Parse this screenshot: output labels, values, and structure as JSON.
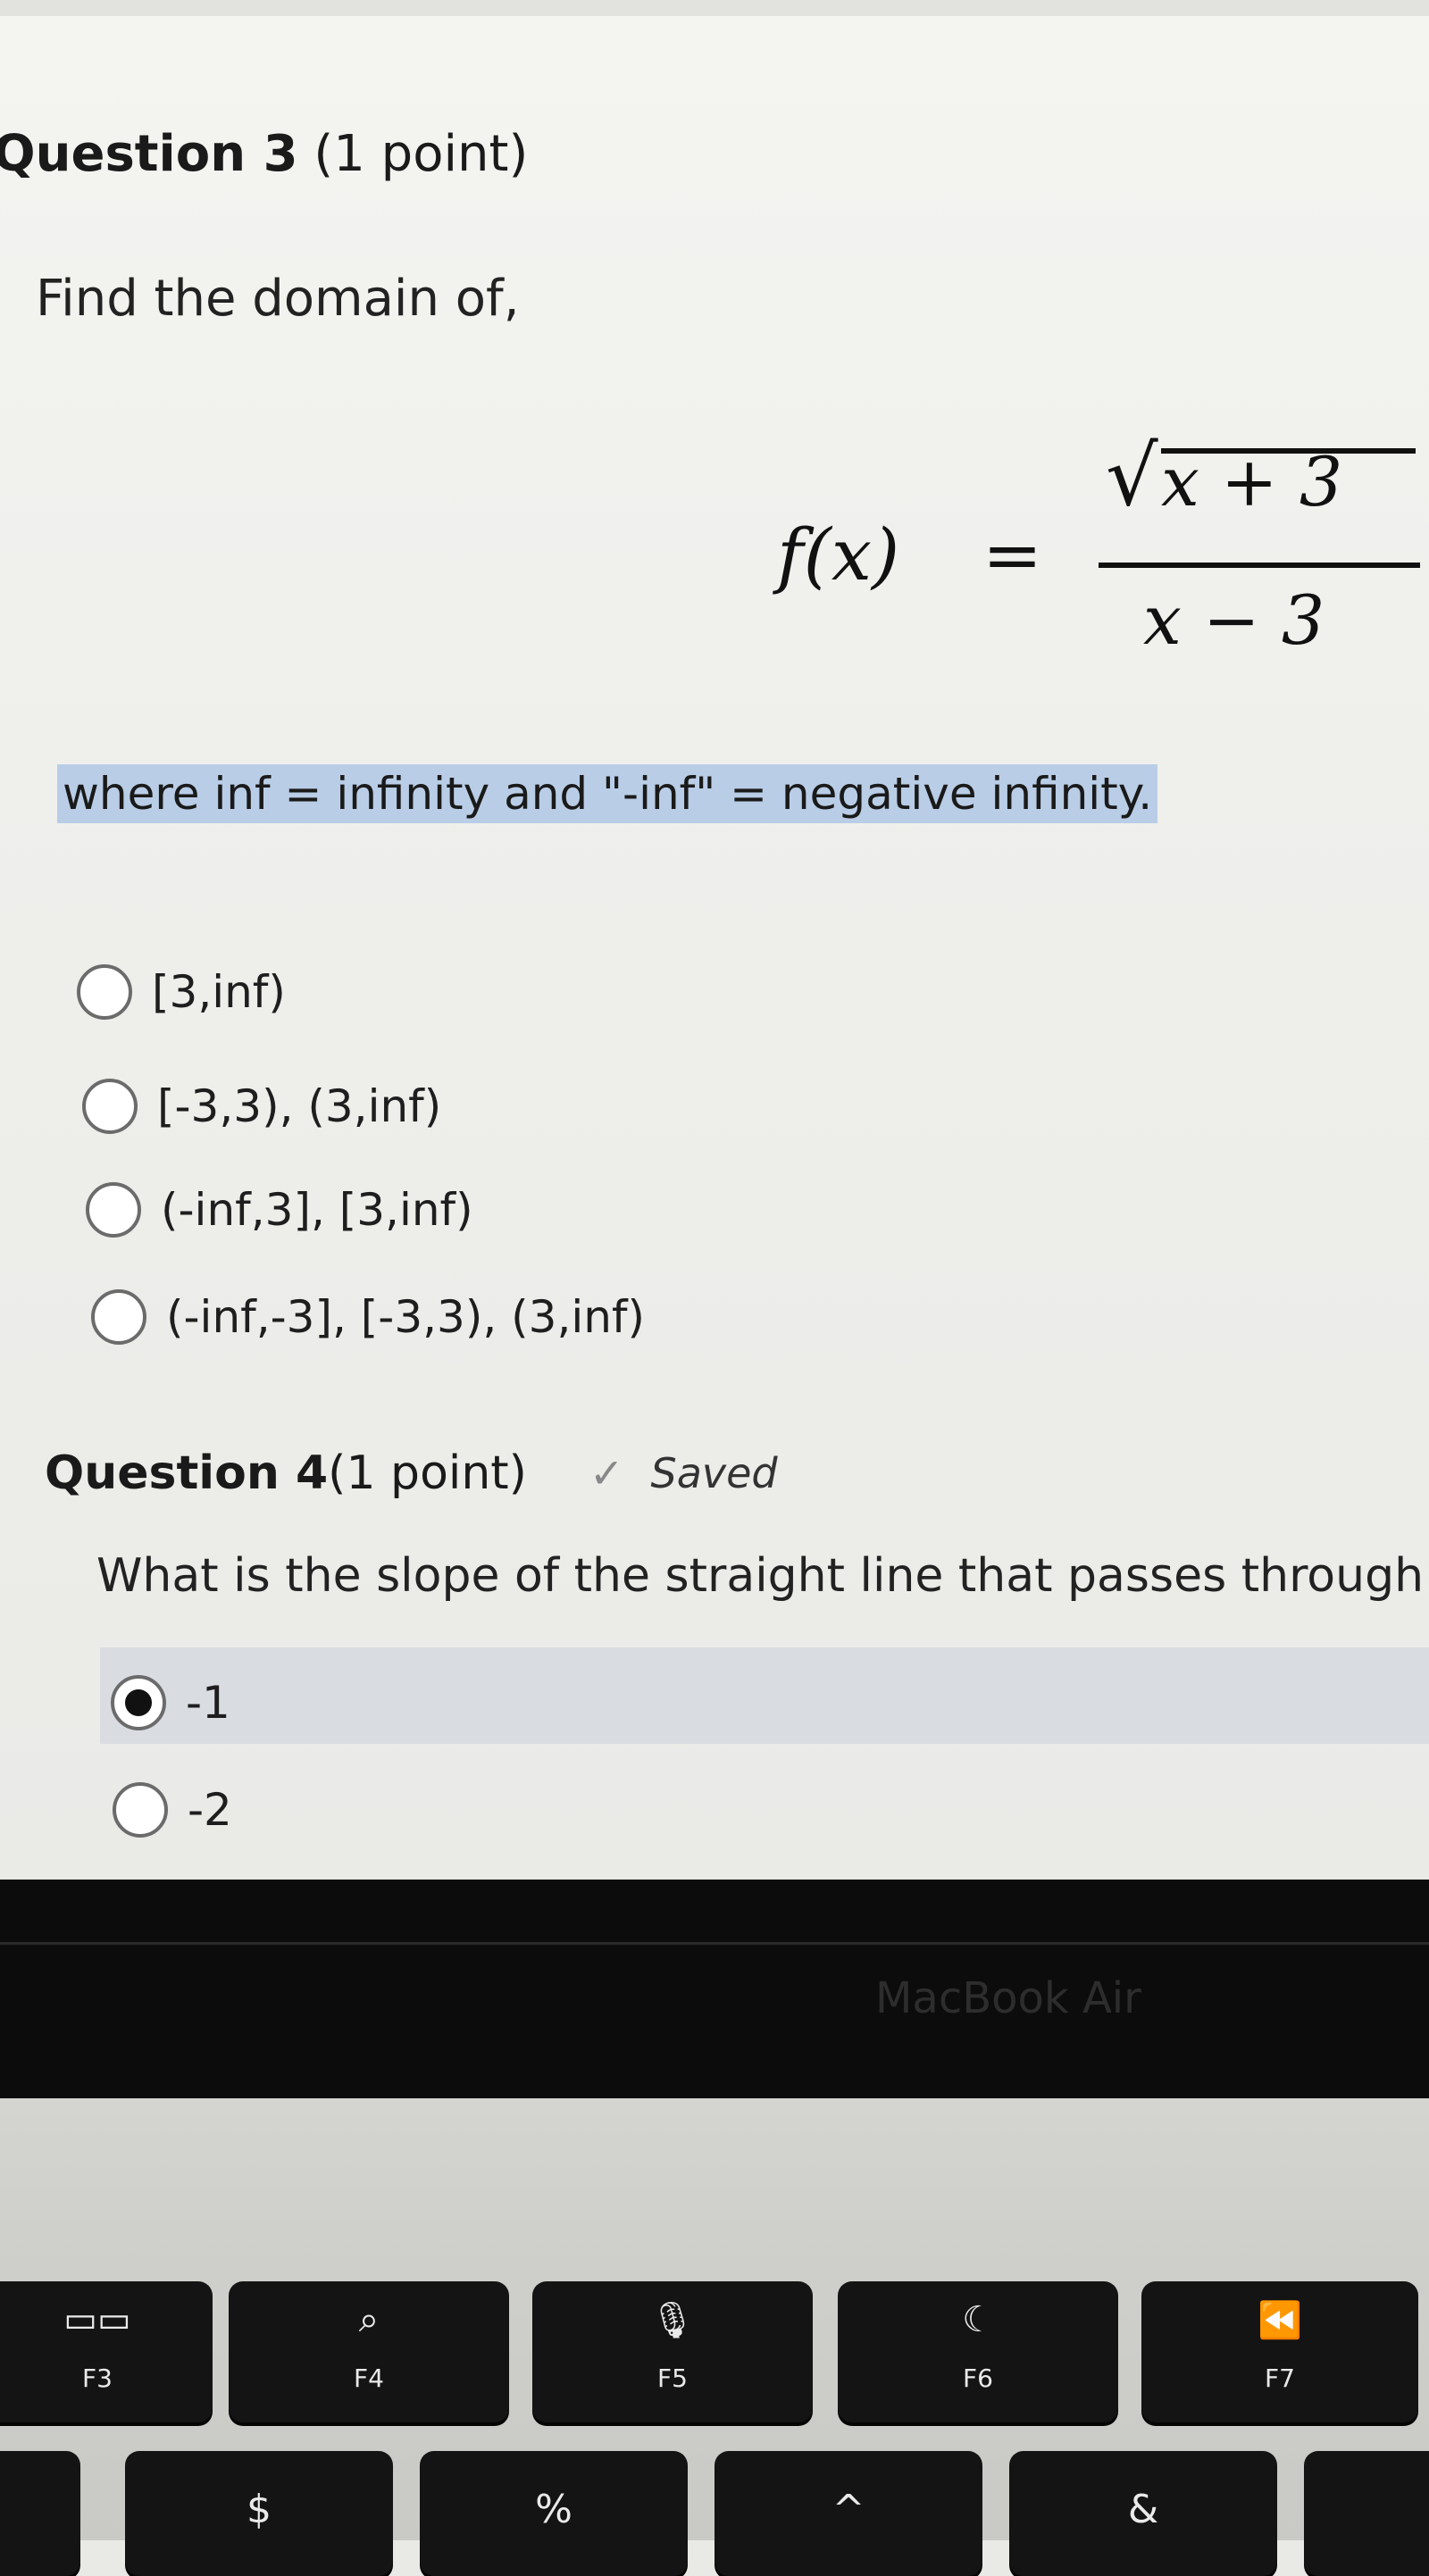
{
  "question3": {
    "title_bold": "Question 3",
    "title_points": " (1 point)",
    "prompt": "Find the domain of,",
    "formula": {
      "lhs": "f(x)",
      "equals": "=",
      "sqrt_symbol": "√",
      "numerator": "x + 3",
      "denominator": "x − 3"
    },
    "note": "where inf = infinity and \"-inf\" = negative infinity.",
    "options": [
      "[3,inf)",
      "[-3,3), (3,inf)",
      "(-inf,3], [3,inf)",
      "(-inf,-3], [-3,3), (3,inf)"
    ]
  },
  "question4": {
    "title_bold": "Question 4",
    "title_points": " (1 point)",
    "check_icon": "checkmark-icon",
    "saved_label": "Saved",
    "prompt": "What is the slope of the straight line that passes through",
    "options": [
      "-1",
      "-2"
    ],
    "selected_index": 0
  },
  "hardware": {
    "brand": "MacBook Air",
    "keys": [
      {
        "icon": "mission-control-icon",
        "glyph": "▭▭",
        "label": "F3"
      },
      {
        "icon": "search-icon",
        "glyph": "⌕",
        "label": "F4"
      },
      {
        "icon": "microphone-icon",
        "glyph": "🎙",
        "label": "F5"
      },
      {
        "icon": "moon-icon",
        "glyph": "☾",
        "label": "F6"
      },
      {
        "icon": "rewind-icon",
        "glyph": "⏪",
        "label": "F7"
      }
    ],
    "number_row_symbols": [
      "$",
      "%",
      "^",
      "&"
    ]
  }
}
